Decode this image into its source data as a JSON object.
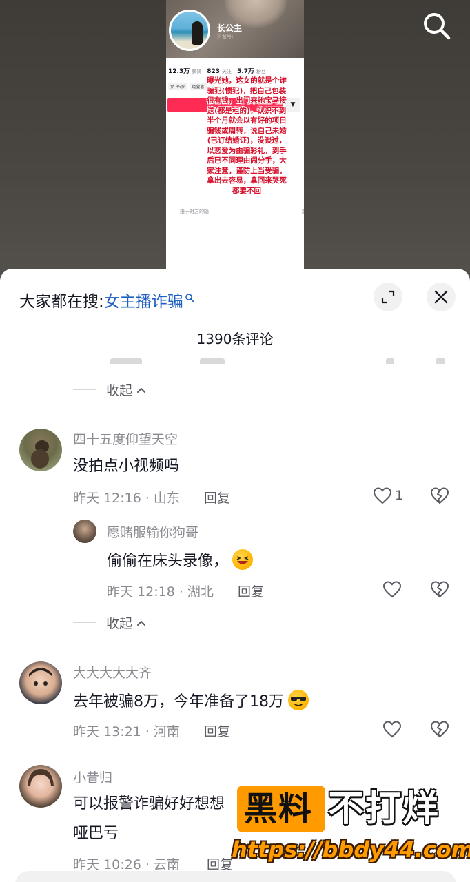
{
  "video": {
    "profile_shot": {
      "name": "长公主",
      "subtitle": "抖音号:",
      "stats": [
        {
          "value": "12.3万",
          "label": "获赞"
        },
        {
          "value": "823",
          "label": "关注"
        },
        {
          "value": "5.7万",
          "label": "粉丝"
        }
      ],
      "tags": [
        "女 35岁",
        "经营者"
      ],
      "more_symbol": "▼",
      "tip": "由于对方的隐",
      "tip_right": "起",
      "overlay_text": "曝光她，这女的就是个诈骗犯(惯犯)，把自己包装很有钱，出门来驰宝马接送(都是租的)，认识不到半个月就会以有好的项目骗钱或周转，说自己未婚(已订结婚证)，没谈过，以恋爱为由骗彩礼，到手后已不同理由闹分手，大家注意，谨防上当受骗，拿出去容易，拿回来哭死都要不回"
    }
  },
  "sheet": {
    "hot_search_prefix": "大家都在搜:",
    "hot_search_keyword": "女主播诈骗",
    "comment_count": "1390条评论",
    "collapse_label": "收起",
    "comments": [
      {
        "user": "四十五度仰望天空",
        "text": "没拍点小视频吗",
        "time": "昨天 12:16 · 山东",
        "reply_label": "回复",
        "likes": "1",
        "replies": [
          {
            "user": "愿赌服输你狗哥",
            "text": "偷偷在床头录像，",
            "time": "昨天 12:18 · 湖北",
            "reply_label": "回复"
          }
        ]
      },
      {
        "user": "大大大大大齐",
        "text": "去年被骗8万，今年准备了18万",
        "time": "昨天 13:21 · 河南",
        "reply_label": "回复"
      },
      {
        "user": "小昔归",
        "text_line1": "可以报警诈骗好好想想",
        "text_line2": "哑巴亏",
        "time": "昨天 10:26 · 云南",
        "reply_label": "回复"
      }
    ]
  },
  "watermark": {
    "box_text": "黑料",
    "side_text": "不打烊",
    "url": "https://bbdy44.com"
  },
  "colors": {
    "accent_red": "#fe2c55",
    "keyword_blue": "#1d5fc1",
    "watermark_orange": "#ff9a00"
  }
}
